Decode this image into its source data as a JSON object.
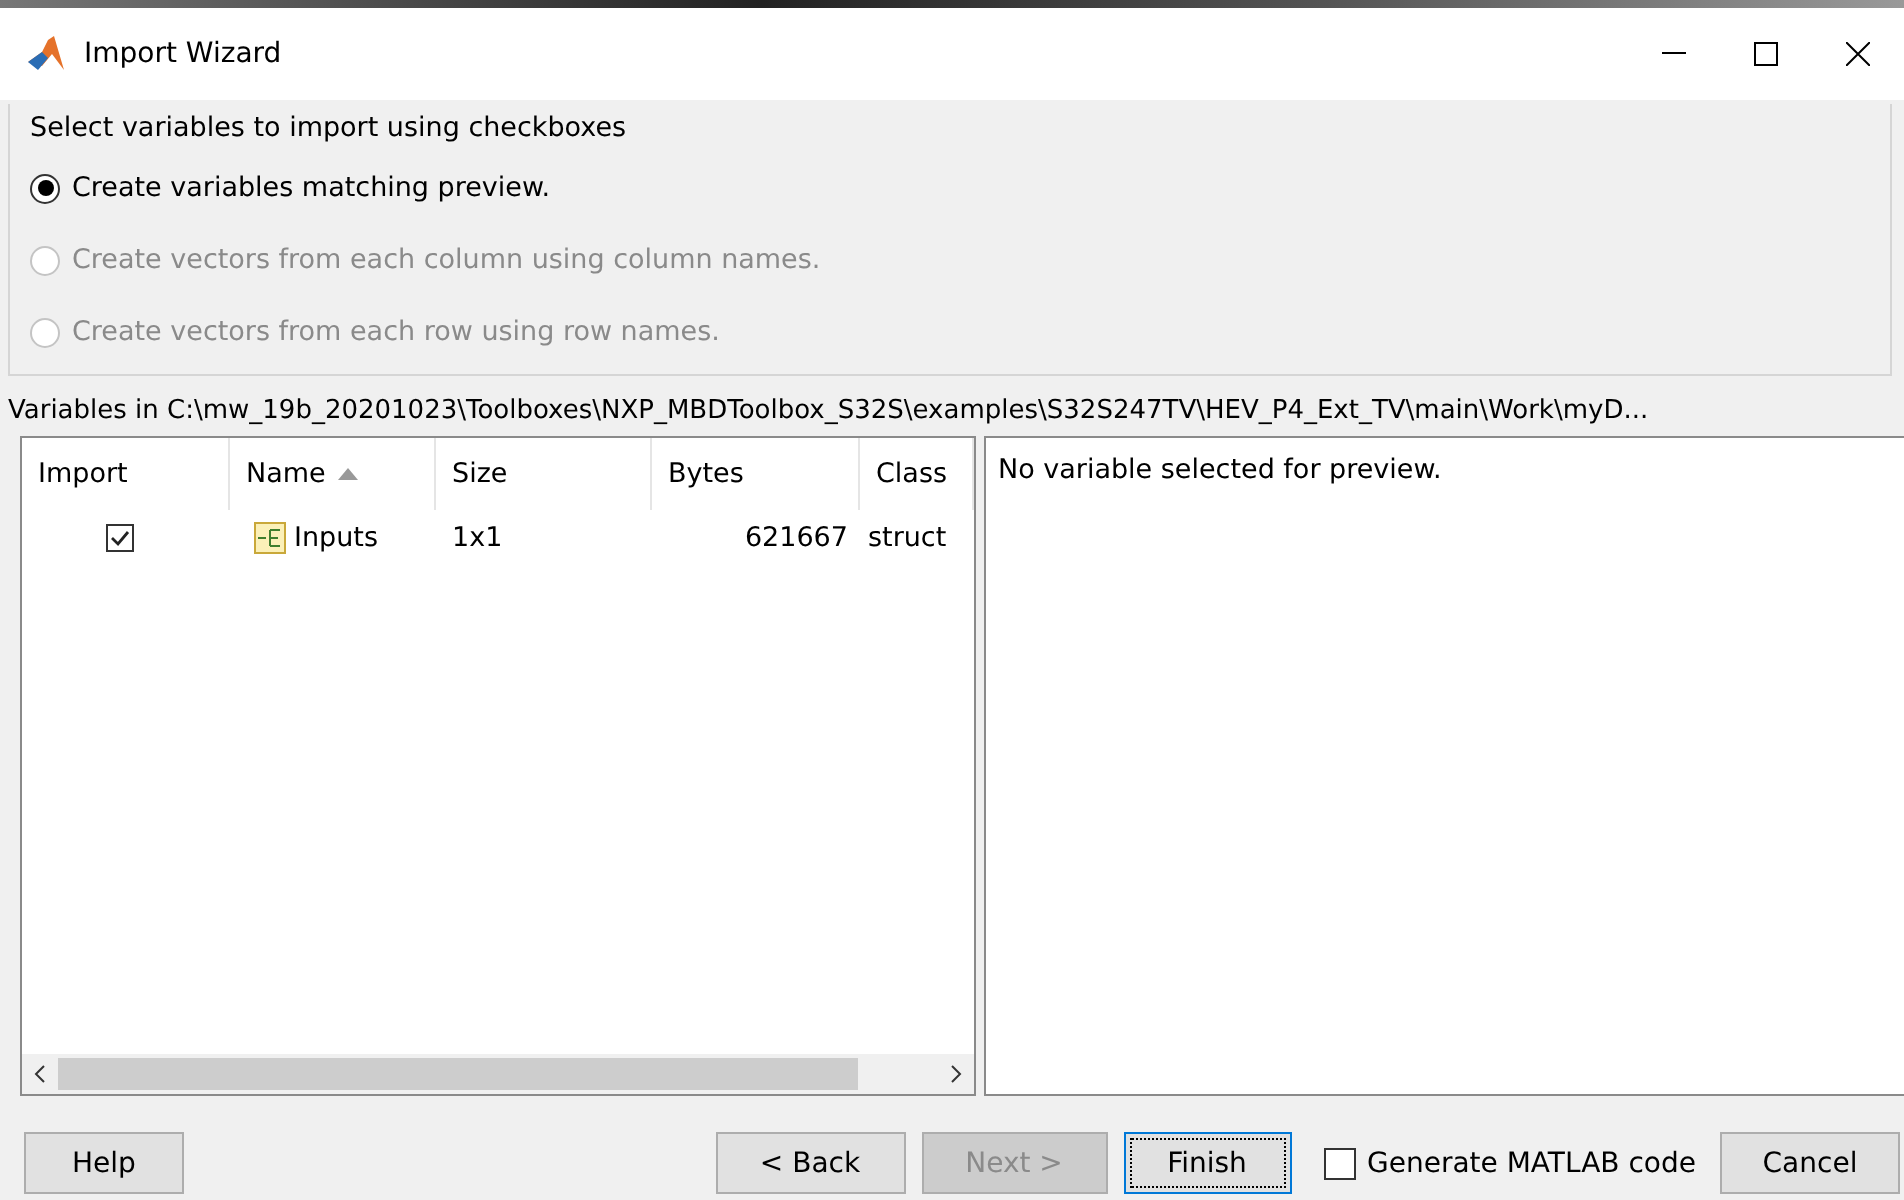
{
  "window": {
    "title": "Import Wizard"
  },
  "options": {
    "label": "Select variables to import using checkboxes",
    "radios": [
      {
        "label": "Create variables matching preview.",
        "selected": true,
        "disabled": false
      },
      {
        "label": "Create vectors from each column using column names.",
        "selected": false,
        "disabled": true
      },
      {
        "label": "Create vectors from each row using row names.",
        "selected": false,
        "disabled": true
      }
    ]
  },
  "path_label": "Variables in C:\\mw_19b_20201023\\Toolboxes\\NXP_MBDToolbox_S32S\\examples\\S32S247TV\\HEV_P4_Ext_TV\\main\\Work\\myD...",
  "table": {
    "columns": [
      {
        "label": "Import",
        "sorted": false
      },
      {
        "label": "Name",
        "sorted": true
      },
      {
        "label": "Size",
        "sorted": false
      },
      {
        "label": "Bytes",
        "sorted": false
      },
      {
        "label": "Class",
        "sorted": false
      }
    ],
    "rows": [
      {
        "checked": true,
        "name": "Inputs",
        "size": "1x1",
        "bytes": "621667",
        "class": "struct"
      }
    ]
  },
  "preview": {
    "text": "No variable selected for preview."
  },
  "buttons": [
    {
      "label": "Help",
      "kind": "button",
      "disabled": false,
      "default": false
    },
    {
      "kind": "spacer"
    },
    {
      "label": "< Back",
      "kind": "button",
      "disabled": false,
      "default": false
    },
    {
      "label": "Next >",
      "kind": "button",
      "disabled": true,
      "default": false
    },
    {
      "label": "Finish",
      "kind": "button",
      "disabled": false,
      "default": true
    },
    {
      "label": "Generate MATLAB code",
      "kind": "checkbox",
      "checked": false
    },
    {
      "label": "Cancel",
      "kind": "button",
      "disabled": false,
      "default": false
    }
  ]
}
